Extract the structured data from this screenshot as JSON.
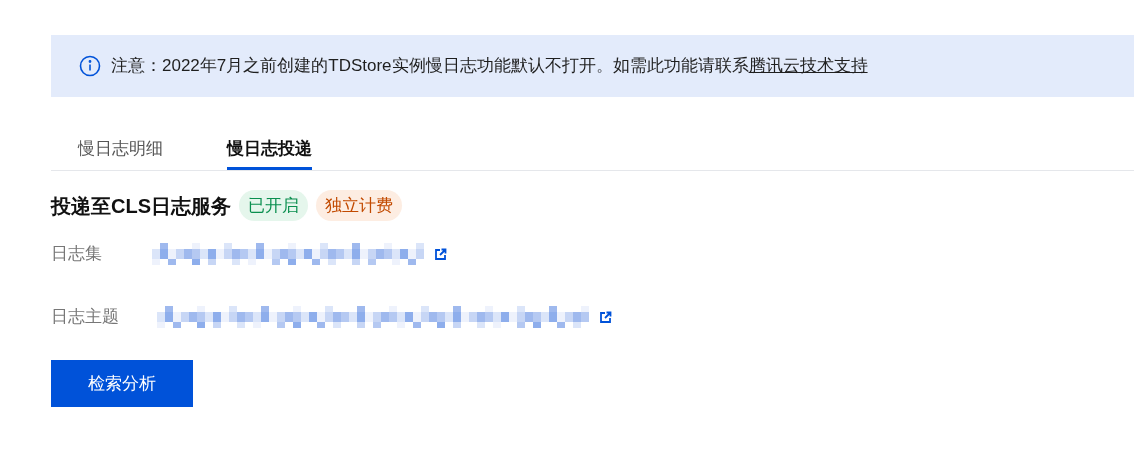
{
  "notice": {
    "text": "注意：2022年7月之前创建的TDStore实例慢日志功能默认不打开。如需此功能请联系",
    "link": "腾讯云技术支持"
  },
  "tabs": [
    {
      "label": "慢日志明细",
      "selected": false
    },
    {
      "label": "慢日志投递",
      "selected": true
    }
  ],
  "section": {
    "title": "投递至CLS日志服务",
    "tags": [
      {
        "label": "已开启",
        "color": "#0a8f4f"
      },
      {
        "label": "独立计费",
        "color": "#c24a00"
      }
    ]
  },
  "fields": [
    {
      "label": "日志集"
    },
    {
      "label": "日志主题"
    }
  ],
  "button": "检索分析"
}
